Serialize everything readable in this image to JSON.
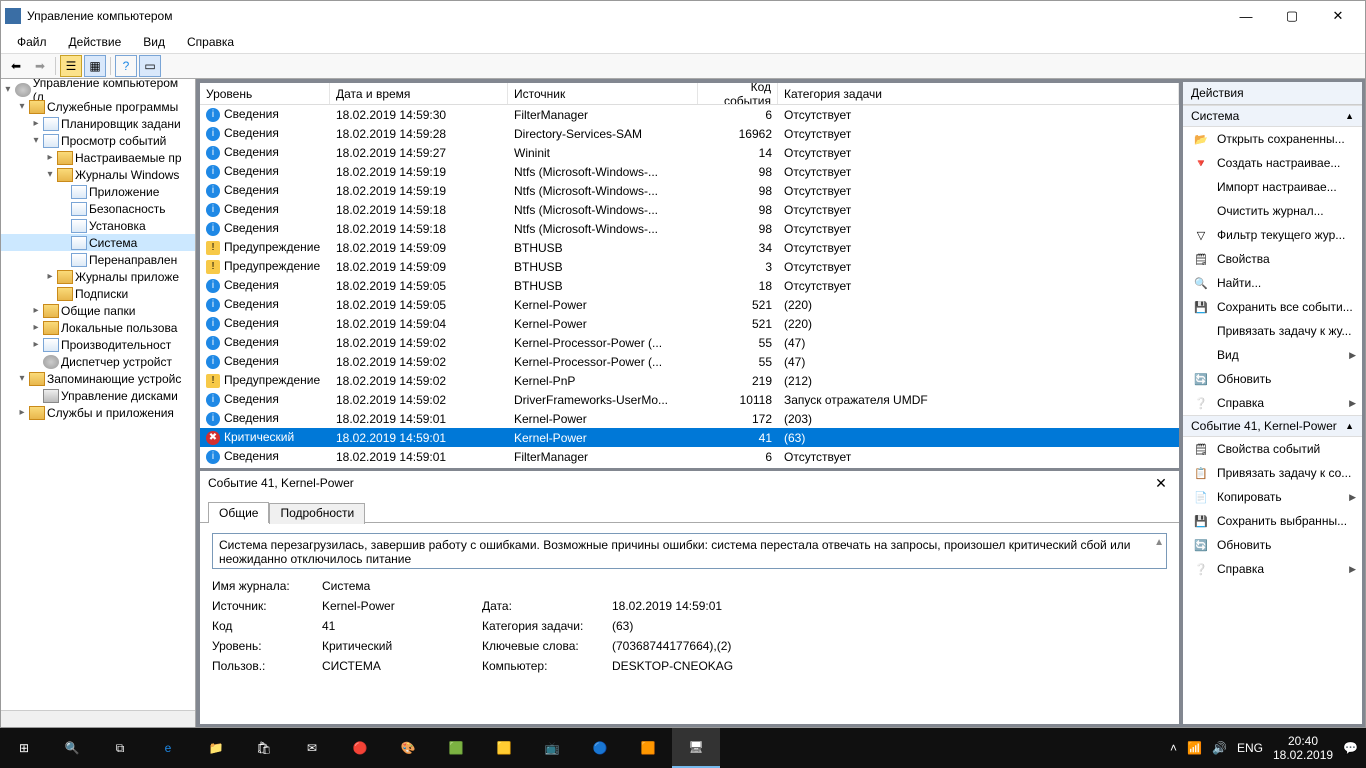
{
  "titlebar": {
    "title": "Управление компьютером"
  },
  "menu": {
    "file": "Файл",
    "action": "Действие",
    "view": "Вид",
    "help": "Справка"
  },
  "tree": [
    {
      "label": "Управление компьютером (л",
      "indent": 0,
      "icon": "gear",
      "toggle": "▾"
    },
    {
      "label": "Служебные программы",
      "indent": 1,
      "icon": "folder",
      "toggle": "▾"
    },
    {
      "label": "Планировщик задани",
      "indent": 2,
      "icon": "doc",
      "toggle": "▸"
    },
    {
      "label": "Просмотр событий",
      "indent": 2,
      "icon": "doc",
      "toggle": "▾"
    },
    {
      "label": "Настраиваемые пр",
      "indent": 3,
      "icon": "folder",
      "toggle": "▸"
    },
    {
      "label": "Журналы Windows",
      "indent": 3,
      "icon": "folder",
      "toggle": "▾"
    },
    {
      "label": "Приложение",
      "indent": 4,
      "icon": "doc",
      "toggle": ""
    },
    {
      "label": "Безопасность",
      "indent": 4,
      "icon": "doc",
      "toggle": ""
    },
    {
      "label": "Установка",
      "indent": 4,
      "icon": "doc",
      "toggle": ""
    },
    {
      "label": "Система",
      "indent": 4,
      "icon": "doc",
      "toggle": "",
      "selected": true
    },
    {
      "label": "Перенаправлен",
      "indent": 4,
      "icon": "doc",
      "toggle": ""
    },
    {
      "label": "Журналы приложе",
      "indent": 3,
      "icon": "folder",
      "toggle": "▸"
    },
    {
      "label": "Подписки",
      "indent": 3,
      "icon": "folder",
      "toggle": ""
    },
    {
      "label": "Общие папки",
      "indent": 2,
      "icon": "folder",
      "toggle": "▸"
    },
    {
      "label": "Локальные пользова",
      "indent": 2,
      "icon": "folder",
      "toggle": "▸"
    },
    {
      "label": "Производительност",
      "indent": 2,
      "icon": "doc",
      "toggle": "▸"
    },
    {
      "label": "Диспетчер устройст",
      "indent": 2,
      "icon": "gear",
      "toggle": ""
    },
    {
      "label": "Запоминающие устройс",
      "indent": 1,
      "icon": "folder",
      "toggle": "▾"
    },
    {
      "label": "Управление дисками",
      "indent": 2,
      "icon": "disk",
      "toggle": ""
    },
    {
      "label": "Службы и приложения",
      "indent": 1,
      "icon": "folder",
      "toggle": "▸"
    }
  ],
  "columns": {
    "level": "Уровень",
    "datetime": "Дата и время",
    "source": "Источник",
    "eventid": "Код события",
    "category": "Категория задачи"
  },
  "events": [
    {
      "lvl": "info",
      "t": "Сведения",
      "dt": "18.02.2019 14:59:30",
      "src": "FilterManager",
      "id": "6",
      "cat": "Отсутствует"
    },
    {
      "lvl": "info",
      "t": "Сведения",
      "dt": "18.02.2019 14:59:28",
      "src": "Directory-Services-SAM",
      "id": "16962",
      "cat": "Отсутствует"
    },
    {
      "lvl": "info",
      "t": "Сведения",
      "dt": "18.02.2019 14:59:27",
      "src": "Wininit",
      "id": "14",
      "cat": "Отсутствует"
    },
    {
      "lvl": "info",
      "t": "Сведения",
      "dt": "18.02.2019 14:59:19",
      "src": "Ntfs (Microsoft-Windows-...",
      "id": "98",
      "cat": "Отсутствует"
    },
    {
      "lvl": "info",
      "t": "Сведения",
      "dt": "18.02.2019 14:59:19",
      "src": "Ntfs (Microsoft-Windows-...",
      "id": "98",
      "cat": "Отсутствует"
    },
    {
      "lvl": "info",
      "t": "Сведения",
      "dt": "18.02.2019 14:59:18",
      "src": "Ntfs (Microsoft-Windows-...",
      "id": "98",
      "cat": "Отсутствует"
    },
    {
      "lvl": "info",
      "t": "Сведения",
      "dt": "18.02.2019 14:59:18",
      "src": "Ntfs (Microsoft-Windows-...",
      "id": "98",
      "cat": "Отсутствует"
    },
    {
      "lvl": "warn",
      "t": "Предупреждение",
      "dt": "18.02.2019 14:59:09",
      "src": "BTHUSB",
      "id": "34",
      "cat": "Отсутствует"
    },
    {
      "lvl": "warn",
      "t": "Предупреждение",
      "dt": "18.02.2019 14:59:09",
      "src": "BTHUSB",
      "id": "3",
      "cat": "Отсутствует"
    },
    {
      "lvl": "info",
      "t": "Сведения",
      "dt": "18.02.2019 14:59:05",
      "src": "BTHUSB",
      "id": "18",
      "cat": "Отсутствует"
    },
    {
      "lvl": "info",
      "t": "Сведения",
      "dt": "18.02.2019 14:59:05",
      "src": "Kernel-Power",
      "id": "521",
      "cat": "(220)"
    },
    {
      "lvl": "info",
      "t": "Сведения",
      "dt": "18.02.2019 14:59:04",
      "src": "Kernel-Power",
      "id": "521",
      "cat": "(220)"
    },
    {
      "lvl": "info",
      "t": "Сведения",
      "dt": "18.02.2019 14:59:02",
      "src": "Kernel-Processor-Power (...",
      "id": "55",
      "cat": "(47)"
    },
    {
      "lvl": "info",
      "t": "Сведения",
      "dt": "18.02.2019 14:59:02",
      "src": "Kernel-Processor-Power (...",
      "id": "55",
      "cat": "(47)"
    },
    {
      "lvl": "warn",
      "t": "Предупреждение",
      "dt": "18.02.2019 14:59:02",
      "src": "Kernel-PnP",
      "id": "219",
      "cat": "(212)"
    },
    {
      "lvl": "info",
      "t": "Сведения",
      "dt": "18.02.2019 14:59:02",
      "src": "DriverFrameworks-UserMo...",
      "id": "10118",
      "cat": "Запуск отражателя UMDF"
    },
    {
      "lvl": "info",
      "t": "Сведения",
      "dt": "18.02.2019 14:59:01",
      "src": "Kernel-Power",
      "id": "172",
      "cat": "(203)"
    },
    {
      "lvl": "crit",
      "t": "Критический",
      "dt": "18.02.2019 14:59:01",
      "src": "Kernel-Power",
      "id": "41",
      "cat": "(63)",
      "selected": true
    },
    {
      "lvl": "info",
      "t": "Сведения",
      "dt": "18.02.2019 14:59:01",
      "src": "FilterManager",
      "id": "6",
      "cat": "Отсутствует"
    }
  ],
  "detail": {
    "title": "Событие 41, Kernel-Power",
    "tab_general": "Общие",
    "tab_details": "Подробности",
    "message": "Система перезагрузилась, завершив работу с ошибками. Возможные причины ошибки: система перестала отвечать на запросы, произошел критический сбой или неожиданно отключилось питание",
    "logName_l": "Имя журнала:",
    "logName_v": "Система",
    "source_l": "Источник:",
    "source_v": "Kernel-Power",
    "date_l": "Дата:",
    "date_v": "18.02.2019 14:59:01",
    "code_l": "Код",
    "code_v": "41",
    "cat_l": "Категория задачи:",
    "cat_v": "(63)",
    "level_l": "Уровень:",
    "level_v": "Критический",
    "kw_l": "Ключевые слова:",
    "kw_v": "(70368744177664),(2)",
    "user_l": "Пользов.:",
    "user_v": "СИСТЕМА",
    "comp_l": "Компьютер:",
    "comp_v": "DESKTOP-CNEOKAG"
  },
  "actions": {
    "hdr": "Действия",
    "g1": "Система",
    "items1": [
      {
        "icon": "📂",
        "label": "Открыть сохраненны..."
      },
      {
        "icon": "🔻",
        "label": "Создать настраивае..."
      },
      {
        "icon": "",
        "label": "Импорт настраивае..."
      },
      {
        "icon": "",
        "label": "Очистить журнал..."
      },
      {
        "icon": "▽",
        "label": "Фильтр текущего жур..."
      },
      {
        "icon": "🗒",
        "label": "Свойства"
      },
      {
        "icon": "🔍",
        "label": "Найти..."
      },
      {
        "icon": "💾",
        "label": "Сохранить все событи..."
      },
      {
        "icon": "",
        "label": "Привязать задачу к жу..."
      },
      {
        "icon": "",
        "label": "Вид",
        "chev": "▶"
      },
      {
        "icon": "🔄",
        "label": "Обновить"
      },
      {
        "icon": "❔",
        "label": "Справка",
        "chev": "▶"
      }
    ],
    "g2": "Событие 41, Kernel-Power",
    "items2": [
      {
        "icon": "🗒",
        "label": "Свойства событий"
      },
      {
        "icon": "📋",
        "label": "Привязать задачу к со..."
      },
      {
        "icon": "📄",
        "label": "Копировать",
        "chev": "▶"
      },
      {
        "icon": "💾",
        "label": "Сохранить выбранны..."
      },
      {
        "icon": "🔄",
        "label": "Обновить"
      },
      {
        "icon": "❔",
        "label": "Справка",
        "chev": "▶"
      }
    ]
  },
  "taskbar": {
    "time": "20:40",
    "date": "18.02.2019",
    "lang": "ENG"
  }
}
